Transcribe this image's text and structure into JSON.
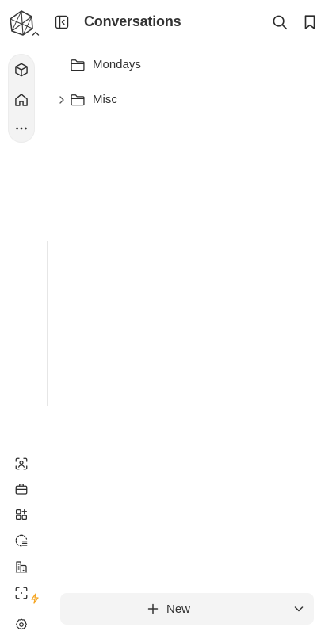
{
  "header": {
    "title": "Conversations"
  },
  "folders": [
    {
      "label": "Mondays",
      "has_children": false
    },
    {
      "label": "Misc",
      "has_children": true
    }
  ],
  "new_button": {
    "label": "New"
  },
  "icons": {
    "logo": "polygon-logo-icon",
    "logo_caret": "chevron-up-icon",
    "rail": [
      "cube-icon",
      "home-icon",
      "more-horizontal-icon"
    ],
    "header": [
      "sidebar-collapse-icon",
      "search-icon",
      "bookmark-icon"
    ],
    "folder": "folder-icon",
    "folder_expand": "chevron-right-icon",
    "tools": [
      "scan-person-icon",
      "briefcase-icon",
      "apps-add-icon",
      "dashed-circle-list-icon",
      "buildings-icon",
      "scan-bolt-icon",
      "settings-gear-icon"
    ],
    "new": [
      "plus-icon",
      "chevron-down-icon"
    ]
  },
  "colors": {
    "accent": "#f5a623",
    "icon": "#2b2b2b",
    "surface": "#f4f4f4"
  }
}
